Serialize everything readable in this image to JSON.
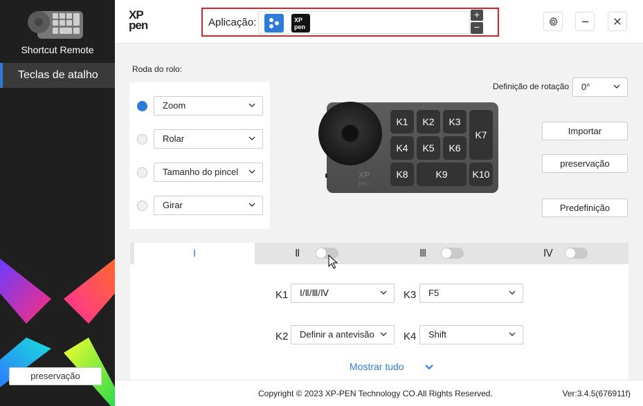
{
  "sidebar": {
    "device_name": "Shortcut Remote",
    "items": [
      {
        "label": "Teclas de atalho"
      }
    ],
    "preset_button": "preservação"
  },
  "header": {
    "logo_line1": "XP",
    "logo_line2": "pen",
    "app_label": "Aplicação:",
    "xp_app_icon_line1": "XP",
    "xp_app_icon_line2": "pen",
    "add_symbol": "+",
    "remove_symbol": "−"
  },
  "wheel": {
    "title": "Roda do rolo:",
    "options": [
      {
        "value": "Zoom",
        "selected": true
      },
      {
        "value": "Rolar",
        "selected": false
      },
      {
        "value": "Tamanho do pincel",
        "selected": false
      },
      {
        "value": "Girar",
        "selected": false
      }
    ]
  },
  "rotation": {
    "label": "Definição de rotação",
    "value": "0°"
  },
  "device": {
    "brand_line1": "XP",
    "brand_line2": "pen",
    "keys": [
      "K1",
      "K2",
      "K3",
      "K7",
      "K4",
      "K5",
      "K6",
      "K8",
      "K9",
      "K10"
    ]
  },
  "actions": {
    "import": "Importar",
    "save": "preservação",
    "default": "Predefinição"
  },
  "tabs": [
    {
      "label": "I",
      "active": true
    },
    {
      "label": "Ⅱ",
      "toggle_on": false
    },
    {
      "label": "Ⅲ",
      "toggle_on": false
    },
    {
      "label": "Ⅳ",
      "toggle_on": false
    }
  ],
  "key_settings": {
    "k1": {
      "label": "K1",
      "value": "Ⅰ/Ⅱ/Ⅲ/Ⅳ"
    },
    "k2": {
      "label": "K2",
      "value": "Definir a antevisão"
    },
    "k3": {
      "label": "K3",
      "value": "F5"
    },
    "k4": {
      "label": "K4",
      "value": "Shift"
    },
    "show_all": "Mostrar tudo"
  },
  "footer": {
    "copyright": "Copyright © 2023  XP-PEN Technology CO.All Rights Reserved.",
    "version": "Ver:3.4.5(676911f)"
  },
  "colors": {
    "accent": "#2d7bd8",
    "highlight_border": "#e0202a",
    "sidebar_bg": "#1f1f1f"
  }
}
